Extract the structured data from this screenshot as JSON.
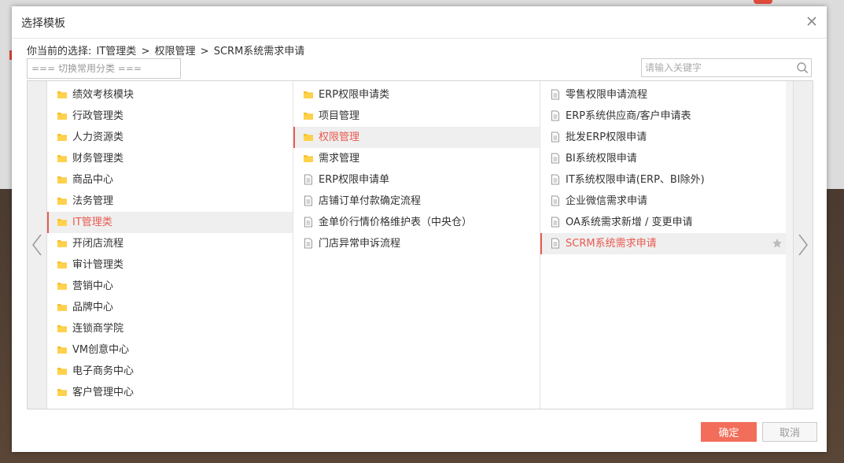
{
  "dialog": {
    "title": "选择模板",
    "current_label": "你当前的选择:",
    "breadcrumb": [
      "IT管理类",
      ">",
      "权限管理",
      ">",
      "SCRM系统需求申请"
    ],
    "category_select": "=== 切换常用分类 ===",
    "search_placeholder": "请输入关键字",
    "confirm_label": "确定",
    "cancel_label": "取消"
  },
  "colors": {
    "accent": "#e85a4f",
    "confirm_bg": "#f26e5a",
    "folder": "#f7c12a"
  },
  "columns": [
    {
      "items": [
        {
          "label": "绩效考核模块",
          "icon": "folder-icon",
          "selected": false
        },
        {
          "label": "行政管理类",
          "icon": "folder-icon",
          "selected": false
        },
        {
          "label": "人力资源类",
          "icon": "folder-icon",
          "selected": false
        },
        {
          "label": "财务管理类",
          "icon": "folder-icon",
          "selected": false
        },
        {
          "label": "商品中心",
          "icon": "folder-icon",
          "selected": false
        },
        {
          "label": "法务管理",
          "icon": "folder-icon",
          "selected": false
        },
        {
          "label": "IT管理类",
          "icon": "folder-icon",
          "selected": true
        },
        {
          "label": "开闭店流程",
          "icon": "folder-icon",
          "selected": false
        },
        {
          "label": "审计管理类",
          "icon": "folder-icon",
          "selected": false
        },
        {
          "label": "营销中心",
          "icon": "folder-icon",
          "selected": false
        },
        {
          "label": "品牌中心",
          "icon": "folder-icon",
          "selected": false
        },
        {
          "label": "连锁商学院",
          "icon": "folder-icon",
          "selected": false
        },
        {
          "label": "VM创意中心",
          "icon": "folder-icon",
          "selected": false
        },
        {
          "label": "电子商务中心",
          "icon": "folder-icon",
          "selected": false
        },
        {
          "label": "客户管理中心",
          "icon": "folder-icon",
          "selected": false
        }
      ]
    },
    {
      "items": [
        {
          "label": "ERP权限申请类",
          "icon": "folder-icon",
          "selected": false
        },
        {
          "label": "项目管理",
          "icon": "folder-icon",
          "selected": false
        },
        {
          "label": "权限管理",
          "icon": "folder-icon",
          "selected": true
        },
        {
          "label": "需求管理",
          "icon": "folder-icon",
          "selected": false
        },
        {
          "label": "ERP权限申请单",
          "icon": "document-icon",
          "selected": false
        },
        {
          "label": "店铺订单付款确定流程",
          "icon": "document-icon",
          "selected": false
        },
        {
          "label": "金单价行情价格维护表（中央仓）",
          "icon": "document-icon",
          "selected": false
        },
        {
          "label": "门店异常申诉流程",
          "icon": "document-icon",
          "selected": false
        }
      ]
    },
    {
      "items": [
        {
          "label": "零售权限申请流程",
          "icon": "document-icon",
          "selected": false
        },
        {
          "label": "ERP系统供应商/客户申请表",
          "icon": "document-icon",
          "selected": false
        },
        {
          "label": "批发ERP权限申请",
          "icon": "document-icon",
          "selected": false
        },
        {
          "label": "BI系统权限申请",
          "icon": "document-icon",
          "selected": false
        },
        {
          "label": "IT系统权限申请(ERP、BI除外)",
          "icon": "document-icon",
          "selected": false
        },
        {
          "label": "企业微信需求申请",
          "icon": "document-icon",
          "selected": false
        },
        {
          "label": "OA系统需求新增 / 变更申请",
          "icon": "document-icon",
          "selected": false
        },
        {
          "label": "SCRM系统需求申请",
          "icon": "document-icon",
          "selected": true,
          "starred": true
        }
      ]
    }
  ]
}
